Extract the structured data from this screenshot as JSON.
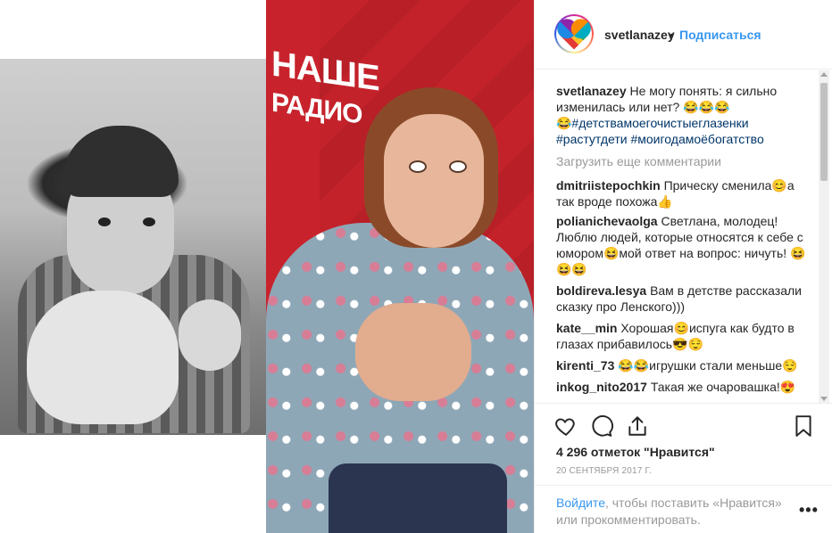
{
  "header": {
    "username": "svetlanazey",
    "separator": "•",
    "follow_label": "Подписаться",
    "avatar_icon": "rainbow-heart-icon"
  },
  "wall_logo": {
    "line1": "НАШЕ",
    "line2": "РАДИО"
  },
  "caption": {
    "username": "svetlanazey",
    "text": "Не могу понять: я сильно изменилась или нет? 😂😂😂",
    "hashtags": "😂#детствамоегочистыеглазенки #растутдети #моигодамоёбогатство"
  },
  "load_more_label": "Загрузить еще комментарии",
  "comments": [
    {
      "username": "dmitriistepochkin",
      "text": "Прическу сменила😊а так вроде похожа👍"
    },
    {
      "username": "polianichevaolga",
      "text": "Светлана, молодец! Люблю людей, которые относятся к себе с юмором😆мой ответ на вопрос: ничуть! 😆😆😆"
    },
    {
      "username": "boldireva.lesya",
      "text": "Вам в детстве рассказали сказку про Ленского)))"
    },
    {
      "username": "kate__min",
      "text": "Хорошая😊испуга как будто в глазах прибавилось😎😌"
    },
    {
      "username": "kirenti_73",
      "text": "😂😂игрушки стали меньше😌"
    },
    {
      "username": "inkog_nito2017",
      "text": "Такая же очаровашка!😍"
    }
  ],
  "actions": {
    "like_icon": "heart-outline-icon",
    "comment_icon": "comment-icon",
    "share_icon": "share-icon",
    "save_icon": "bookmark-icon"
  },
  "likes_text": "4 296 отметок \"Нравится\"",
  "date_text": "20 сентября 2017 г.",
  "login": {
    "link_label": "Войдите",
    "text": ", чтобы поставить «Нравится» или прокомментировать.",
    "more_label": "•••"
  }
}
